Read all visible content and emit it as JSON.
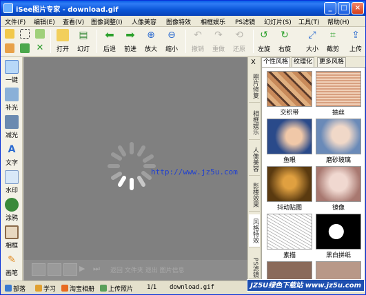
{
  "window": {
    "title": "iSee图片专家 - download.gif",
    "min_label": "_",
    "max_label": "□",
    "close_label": "×"
  },
  "menu": [
    "文件(F)",
    "编辑(E)",
    "查看(V)",
    "图像调整(I)",
    "人像美容",
    "图像特效",
    "相框娱乐",
    "PS滤镜",
    "幻灯片(S)",
    "工具(T)",
    "帮助(H)"
  ],
  "toolbar": {
    "open": "打开",
    "slideshow": "幻灯",
    "back": "后退",
    "forward": "前进",
    "zoom_in": "放大",
    "zoom_out": "缩小",
    "undo": "撤销",
    "redo": "重做",
    "restore": "还原",
    "rotate_left": "左旋",
    "rotate_right": "右旋",
    "size": "大小",
    "crop": "截剪",
    "upload": "上传"
  },
  "left_tools": [
    "一键",
    "补光",
    "减光",
    "文字",
    "水印",
    "涂鸦",
    "相框",
    "画笔"
  ],
  "canvas": {
    "watermark": "http://www.jz5u.com",
    "nav_ghost_text": "返回 文件夹 退出 图片信息"
  },
  "right_panel": {
    "close": "X",
    "vertical_tabs": [
      "照片修复",
      "相框娱乐",
      "人像美容",
      "影楼效果",
      "风格特效",
      "PS滤镜"
    ],
    "active_vertical_tab": "风格特效",
    "tabs": [
      "个性风格",
      "纹理化",
      "更多风格"
    ],
    "active_tab": "个性风格",
    "effects": [
      "交织带",
      "抽丝",
      "鱼眼",
      "磨砂玻璃",
      "抖动贴图",
      "镜像",
      "素描",
      "黑白拼纸"
    ]
  },
  "status": {
    "blog": "部落",
    "learn": "学习",
    "taobao": "淘宝相册",
    "upload": "上传照片",
    "page": "1/1",
    "filename": "download.gif"
  },
  "site_badge": "JZ5U绿色下载站 www.jz5u.com",
  "colors": {
    "title_blue": "#0b56d8",
    "canvas_gray": "#808080",
    "watermark_blue": "#1e3fd2"
  }
}
